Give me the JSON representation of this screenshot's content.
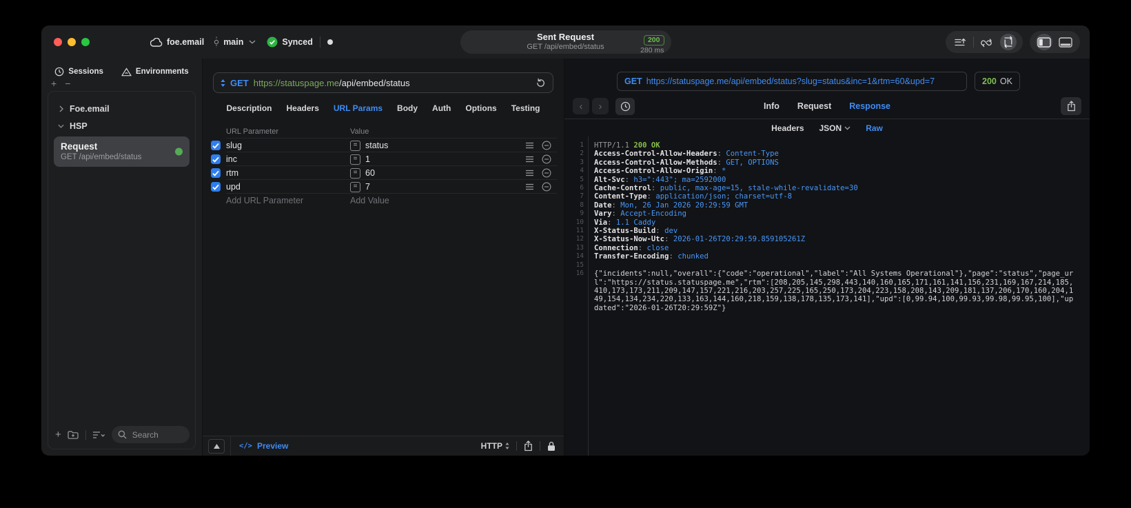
{
  "titlebar": {
    "account": "foe.email",
    "branch": "main",
    "sync_status": "Synced",
    "title": "Sent Request",
    "subtitle": "GET /api/embed/status",
    "status_code": "200",
    "duration": "280 ms"
  },
  "sidebar": {
    "tabs": [
      {
        "label": "Sessions",
        "icon": "clock-icon"
      },
      {
        "label": "Environments",
        "icon": "environments-icon"
      }
    ],
    "tree": [
      {
        "label": "Foe.email",
        "expanded": false
      },
      {
        "label": "HSP",
        "expanded": true
      }
    ],
    "request_item": {
      "title": "Request",
      "subtitle": "GET /api/embed/status",
      "status_dot_color": "#55ab55"
    },
    "search_placeholder": "Search"
  },
  "request_pane": {
    "method": "GET",
    "url_host": "https://statuspage.me",
    "url_path": "/api/embed/status",
    "tabs": [
      "Description",
      "Headers",
      "URL Params",
      "Body",
      "Auth",
      "Options",
      "Testing"
    ],
    "active_tab": "URL Params",
    "table": {
      "param_header": "URL Parameter",
      "value_header": "Value",
      "rows": [
        {
          "checked": true,
          "name": "slug",
          "value": "status"
        },
        {
          "checked": true,
          "name": "inc",
          "value": "1"
        },
        {
          "checked": true,
          "name": "rtm",
          "value": "60"
        },
        {
          "checked": true,
          "name": "upd",
          "value": "7"
        }
      ],
      "add_param": "Add URL Parameter",
      "add_value": "Add Value"
    },
    "footer": {
      "code_glyph": "</>",
      "preview": "Preview",
      "protocol": "HTTP"
    }
  },
  "response_pane": {
    "request_line_method": "GET",
    "request_line_url": "https://statuspage.me/api/embed/status?slug=status&inc=1&rtm=60&upd=7",
    "status_code": "200",
    "status_text": "OK",
    "tabs": [
      {
        "label": "Info",
        "active": false
      },
      {
        "label": "Request",
        "active": false
      },
      {
        "label": "Response",
        "active": true
      }
    ],
    "subtabs": [
      {
        "label": "Headers",
        "active": false,
        "chevron": false
      },
      {
        "label": "JSON",
        "active": false,
        "chevron": true
      },
      {
        "label": "Raw",
        "active": true,
        "chevron": false
      }
    ],
    "raw": {
      "status_protocol": "HTTP/1.1",
      "status": "200 OK",
      "headers": [
        {
          "name": "Access-Control-Allow-Headers",
          "value": "Content-Type"
        },
        {
          "name": "Access-Control-Allow-Methods",
          "value": "GET, OPTIONS"
        },
        {
          "name": "Access-Control-Allow-Origin",
          "value": "*"
        },
        {
          "name": "Alt-Svc",
          "value": "h3=\":443\"; ma=2592000"
        },
        {
          "name": "Cache-Control",
          "value": "public, max-age=15, stale-while-revalidate=30"
        },
        {
          "name": "Content-Type",
          "value": "application/json; charset=utf-8"
        },
        {
          "name": "Date",
          "value": "Mon, 26 Jan 2026 20:29:59 GMT"
        },
        {
          "name": "Vary",
          "value": "Accept-Encoding"
        },
        {
          "name": "Via",
          "value": "1.1 Caddy"
        },
        {
          "name": "X-Status-Build",
          "value": "dev"
        },
        {
          "name": "X-Status-Now-Utc",
          "value": "2026-01-26T20:29:59.859105261Z"
        },
        {
          "name": "Connection",
          "value": "close"
        },
        {
          "name": "Transfer-Encoding",
          "value": "chunked"
        }
      ],
      "body": "{\"incidents\":null,\"overall\":{\"code\":\"operational\",\"label\":\"All Systems Operational\"},\"page\":\"status\",\"page_url\":\"https://status.statuspage.me\",\"rtm\":[208,205,145,298,443,140,160,165,171,161,141,156,231,169,167,214,185,410,173,173,211,209,147,157,221,216,203,257,225,165,250,173,204,223,158,208,143,209,181,137,206,170,160,204,149,154,134,234,220,133,163,144,160,218,159,138,178,135,173,141],\"upd\":[0,99.94,100,99.93,99.98,99.95,100],\"updated\":\"2026-01-26T20:29:59Z\"}"
    }
  },
  "colors": {
    "accent_blue": "#3f8cf3",
    "status_green": "#7cbf52",
    "url_host_green": "#7cab5f",
    "checkbox_blue": "#2e7ef0"
  }
}
